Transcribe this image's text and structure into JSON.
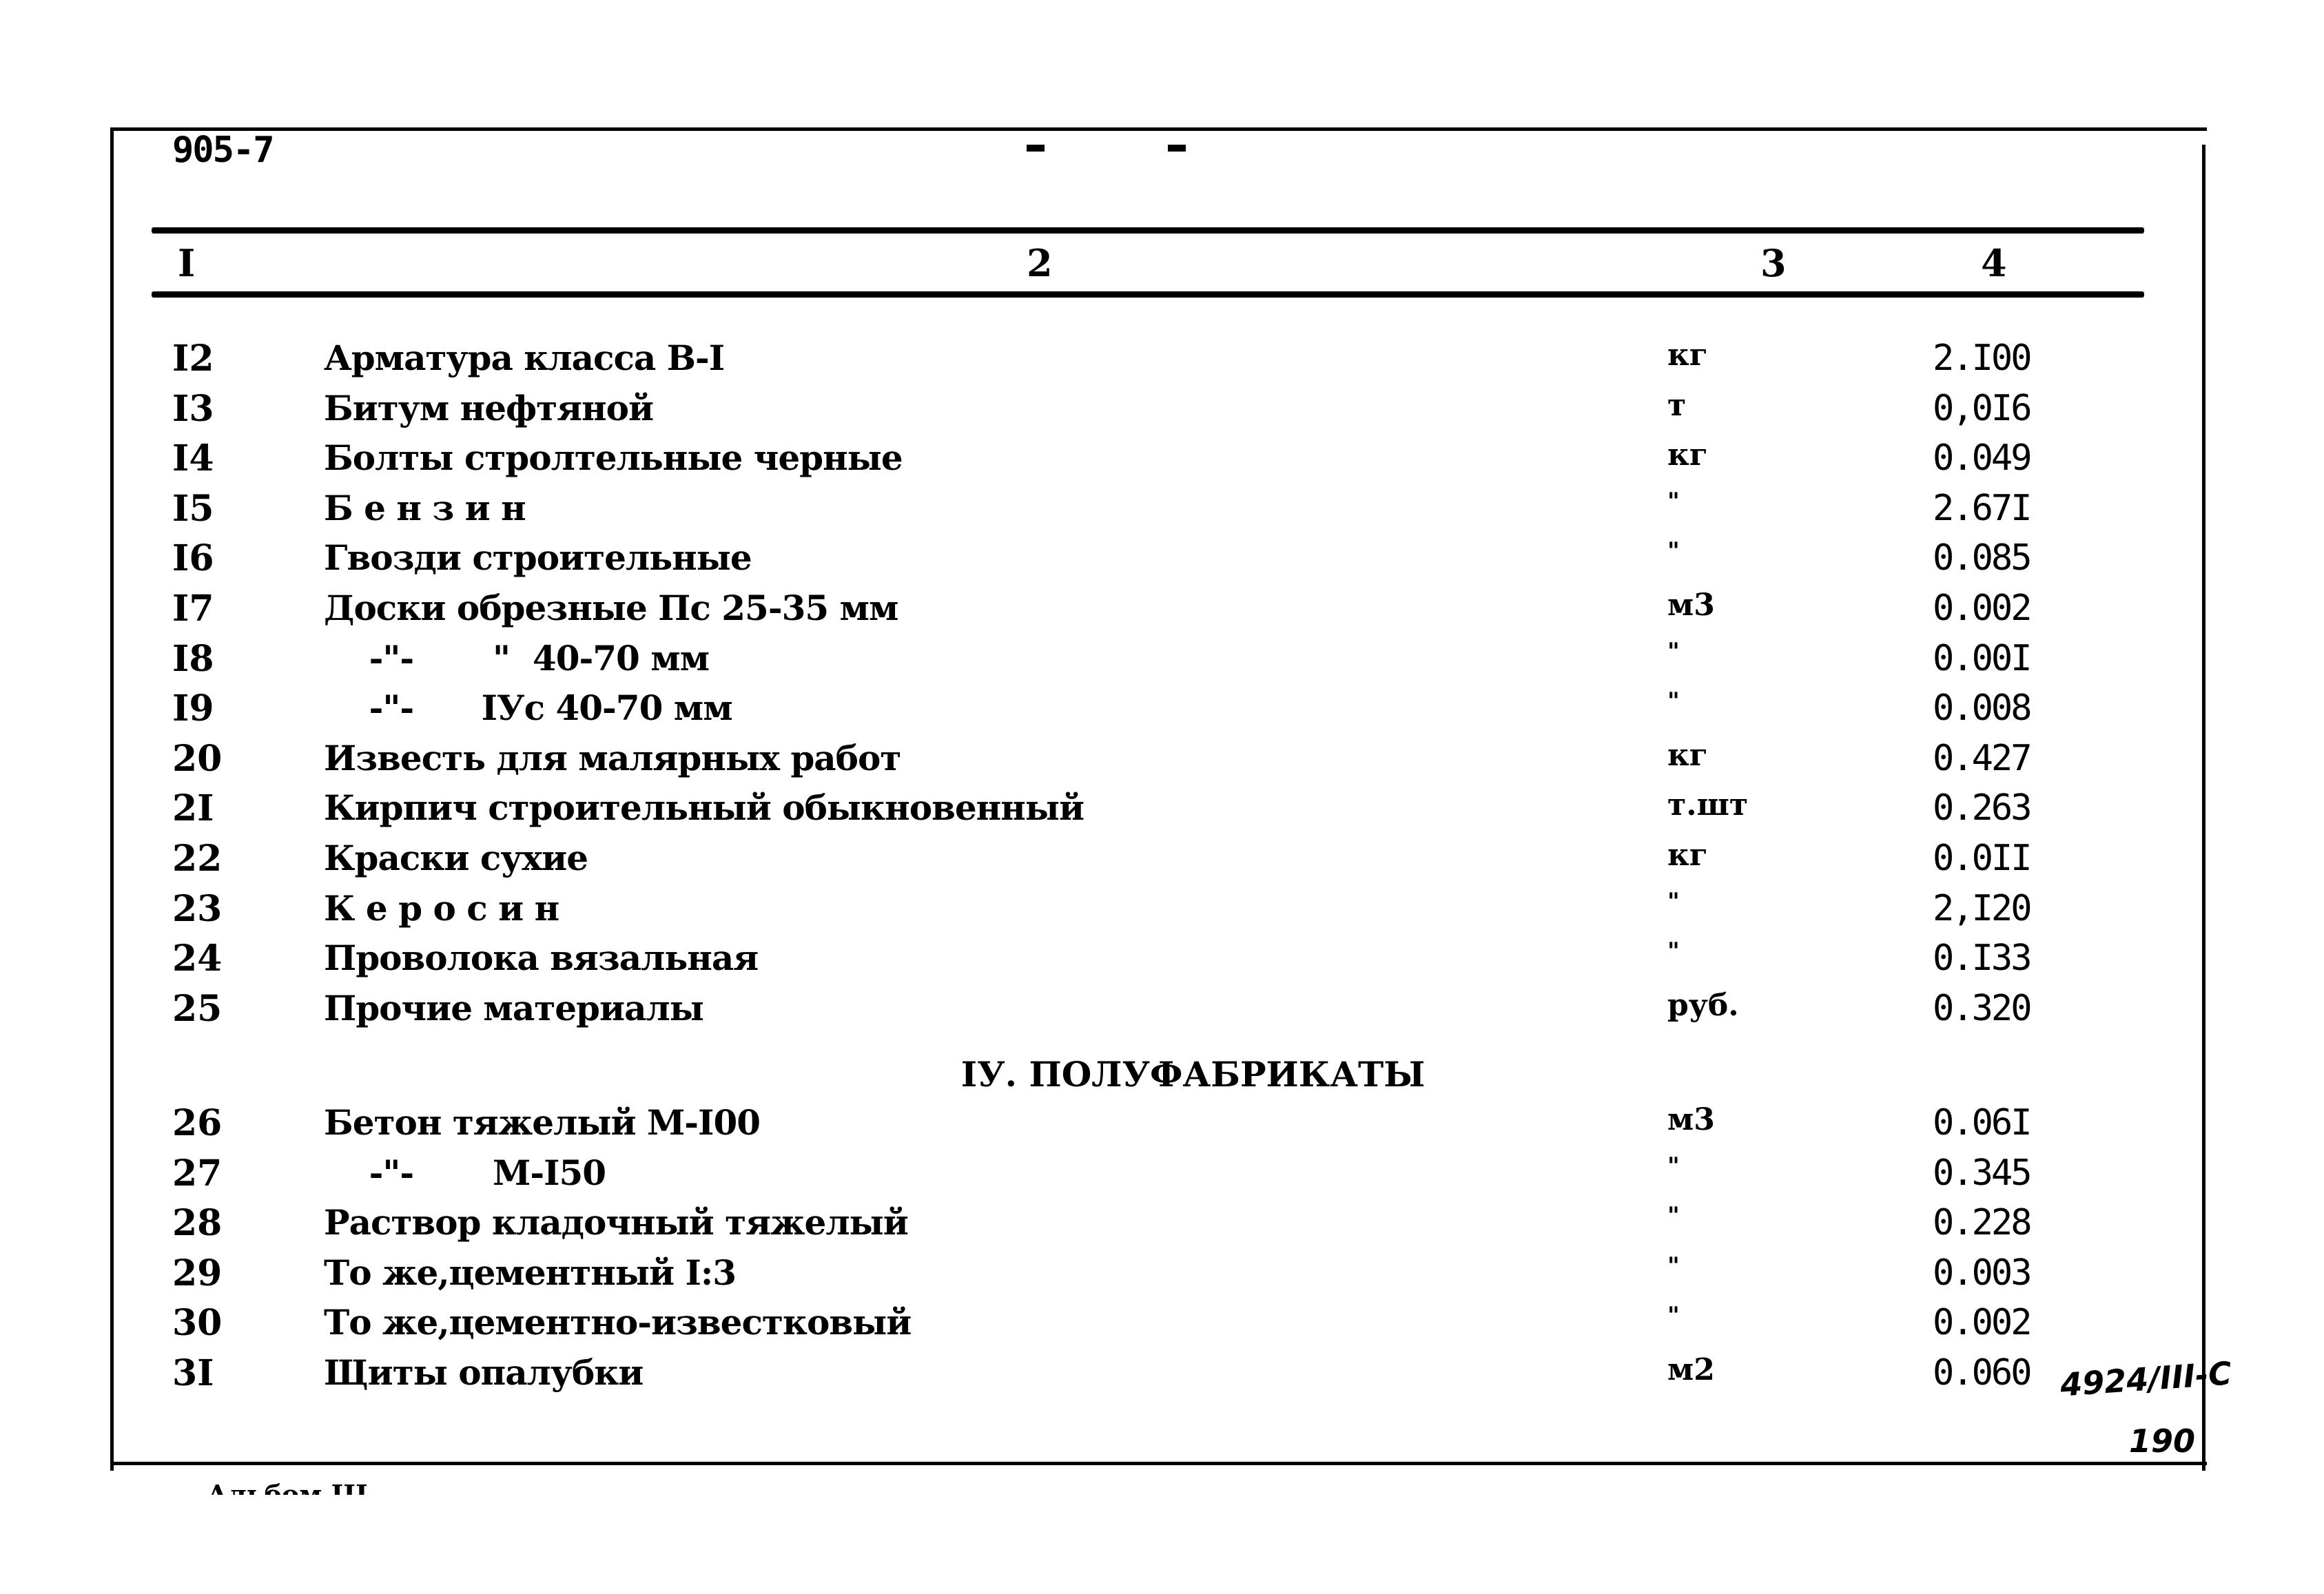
{
  "document": {
    "code": "905-7",
    "top_marks": [
      "-",
      "-"
    ],
    "column_headers": [
      "I",
      "2",
      "3",
      "4"
    ],
    "rows_part1": [
      {
        "num": "I2",
        "name": "Арматура класса В-I",
        "unit": "кг",
        "value": "2.I00"
      },
      {
        "num": "I3",
        "name": "Битум нефтяной",
        "unit": "т",
        "value": "0,0I6"
      },
      {
        "num": "I4",
        "name": "Болты стролтельные черные",
        "unit": "кг",
        "value": "0.049"
      },
      {
        "num": "I5",
        "name": "Б е н з и н",
        "unit": "\"",
        "value": "2.67I"
      },
      {
        "num": "I6",
        "name": "Гвозди строительные",
        "unit": "\"",
        "value": "0.085"
      },
      {
        "num": "I7",
        "name": "Доски обрезные Пс 25-35 мм",
        "unit": "м3",
        "value": "0.002"
      },
      {
        "num": "I8",
        "name": "    -\"-       \"  40-70 мм",
        "unit": "\"",
        "value": "0.00I"
      },
      {
        "num": "I9",
        "name": "    -\"-      IУс 40-70 мм",
        "unit": "\"",
        "value": "0.008"
      },
      {
        "num": "20",
        "name": "Известь для малярных работ",
        "unit": "кг",
        "value": "0.427"
      },
      {
        "num": "2I",
        "name": "Кирпич строительный обыкновенный",
        "unit": "т.шт",
        "value": "0.263"
      },
      {
        "num": "22",
        "name": "Краски сухие",
        "unit": "кг",
        "value": "0.0II"
      },
      {
        "num": "23",
        "name": "К е р о с и н",
        "unit": "\"",
        "value": "2,I20"
      },
      {
        "num": "24",
        "name": "Проволока вязальная",
        "unit": "\"",
        "value": "0.I33"
      },
      {
        "num": "25",
        "name": "Прочие материалы",
        "unit": "руб.",
        "value": "0.320"
      }
    ],
    "section_title": "IУ. ПОЛУФАБРИКАТЫ",
    "rows_part2": [
      {
        "num": "26",
        "name": "Бетон тяжелый М-I00",
        "unit": "м3",
        "value": "0.06I"
      },
      {
        "num": "27",
        "name": "    -\"-       М-I50",
        "unit": "\"",
        "value": "0.345"
      },
      {
        "num": "28",
        "name": "Раствор кладочный тяжелый",
        "unit": "\"",
        "value": "0.228"
      },
      {
        "num": "29",
        "name": "То же,цементный I:3",
        "unit": "\"",
        "value": "0.003"
      },
      {
        "num": "30",
        "name": "То же,цементно-известковый",
        "unit": "\"",
        "value": "0.002"
      },
      {
        "num": "3I",
        "name": "Щиты опалубки",
        "unit": "м2",
        "value": "0.060"
      }
    ],
    "handwritten_ref": "4924/III-C",
    "handwritten_page": "190",
    "footer_fragment": "Альбом III"
  }
}
